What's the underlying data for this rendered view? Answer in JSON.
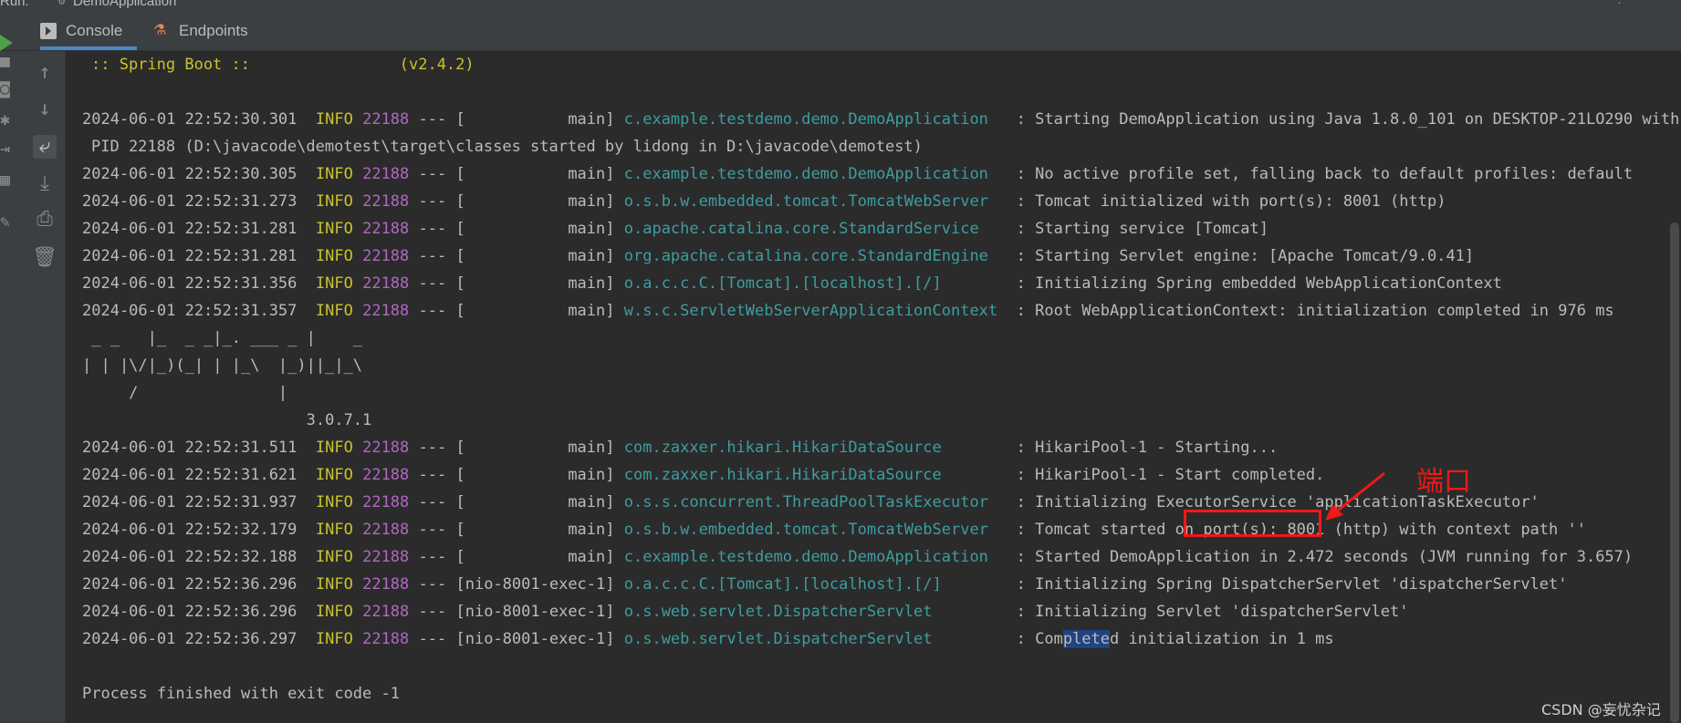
{
  "window": {
    "title": "DemoApplication",
    "title_prefix": "Run:"
  },
  "tabs": [
    {
      "label": "Console",
      "icon": "console-icon",
      "active": true
    },
    {
      "label": "Endpoints",
      "icon": "endpoints-icon",
      "active": false
    }
  ],
  "toolbar": [
    {
      "name": "scroll-up-icon",
      "glyph": "↑"
    },
    {
      "name": "scroll-down-icon",
      "glyph": "↓"
    },
    {
      "name": "soft-wrap-icon",
      "glyph": "⤶",
      "active": true
    },
    {
      "name": "scroll-to-end-icon",
      "glyph": "⤓"
    },
    {
      "name": "print-icon",
      "glyph": "⎙"
    },
    {
      "name": "trash-icon",
      "glyph": "🗑"
    }
  ],
  "toolbar_edge": [
    {
      "name": "stop-icon",
      "glyph": "■"
    },
    {
      "name": "camera-icon",
      "glyph": "◙"
    },
    {
      "name": "settings-icon",
      "glyph": "✱"
    },
    {
      "name": "login-icon",
      "glyph": "⇥"
    },
    {
      "name": "layout-icon",
      "glyph": "▦"
    },
    {
      "name": "pin-icon",
      "glyph": "✎"
    }
  ],
  "console": {
    "banner": ":: Spring Boot ::                (v2.4.2)",
    "ascii_art": [
      " _ _   |_  _ _|_. ___ _ |    _",
      "| | |\\/|_)(_| | |_\\  |_)||_|_\\",
      "     /               |",
      "                        3.0.7.1"
    ],
    "log": [
      {
        "ts": "2024-06-01 22:52:30.301",
        "level": "INFO",
        "pid": "22188",
        "sep": "---",
        "thread": "[           main]",
        "logger": "c.example.testdemo.demo.DemoApplication  ",
        "message": "Starting DemoApplication using Java 1.8.0_101 on DESKTOP-21LO290 with",
        "continuation": "PID 22188 (D:\\javacode\\demotest\\target\\classes started by lidong in D:\\javacode\\demotest)"
      },
      {
        "ts": "2024-06-01 22:52:30.305",
        "level": "INFO",
        "pid": "22188",
        "sep": "---",
        "thread": "[           main]",
        "logger": "c.example.testdemo.demo.DemoApplication  ",
        "message": "No active profile set, falling back to default profiles: default"
      },
      {
        "ts": "2024-06-01 22:52:31.273",
        "level": "INFO",
        "pid": "22188",
        "sep": "---",
        "thread": "[           main]",
        "logger": "o.s.b.w.embedded.tomcat.TomcatWebServer  ",
        "message": "Tomcat initialized with port(s): 8001 (http)"
      },
      {
        "ts": "2024-06-01 22:52:31.281",
        "level": "INFO",
        "pid": "22188",
        "sep": "---",
        "thread": "[           main]",
        "logger": "o.apache.catalina.core.StandardService   ",
        "message": "Starting service [Tomcat]"
      },
      {
        "ts": "2024-06-01 22:52:31.281",
        "level": "INFO",
        "pid": "22188",
        "sep": "---",
        "thread": "[           main]",
        "logger": "org.apache.catalina.core.StandardEngine  ",
        "message": "Starting Servlet engine: [Apache Tomcat/9.0.41]"
      },
      {
        "ts": "2024-06-01 22:52:31.356",
        "level": "INFO",
        "pid": "22188",
        "sep": "---",
        "thread": "[           main]",
        "logger": "o.a.c.c.C.[Tomcat].[localhost].[/]       ",
        "message": "Initializing Spring embedded WebApplicationContext"
      },
      {
        "ts": "2024-06-01 22:52:31.357",
        "level": "INFO",
        "pid": "22188",
        "sep": "---",
        "thread": "[           main]",
        "logger": "w.s.c.ServletWebServerApplicationContext ",
        "message": "Root WebApplicationContext: initialization completed in 976 ms"
      },
      {
        "ts": "2024-06-01 22:52:31.511",
        "level": "INFO",
        "pid": "22188",
        "sep": "---",
        "thread": "[           main]",
        "logger": "com.zaxxer.hikari.HikariDataSource       ",
        "message": "HikariPool-1 - Starting..."
      },
      {
        "ts": "2024-06-01 22:52:31.621",
        "level": "INFO",
        "pid": "22188",
        "sep": "---",
        "thread": "[           main]",
        "logger": "com.zaxxer.hikari.HikariDataSource       ",
        "message": "HikariPool-1 - Start completed."
      },
      {
        "ts": "2024-06-01 22:52:31.937",
        "level": "INFO",
        "pid": "22188",
        "sep": "---",
        "thread": "[           main]",
        "logger": "o.s.s.concurrent.ThreadPoolTaskExecutor  ",
        "message": "Initializing ExecutorService 'applicationTaskExecutor'"
      },
      {
        "ts": "2024-06-01 22:52:32.179",
        "level": "INFO",
        "pid": "22188",
        "sep": "---",
        "thread": "[           main]",
        "logger": "o.s.b.w.embedded.tomcat.TomcatWebServer  ",
        "message": "Tomcat started on port(s): 8001 (http) with context path ''"
      },
      {
        "ts": "2024-06-01 22:52:32.188",
        "level": "INFO",
        "pid": "22188",
        "sep": "---",
        "thread": "[           main]",
        "logger": "c.example.testdemo.demo.DemoApplication  ",
        "message": "Started DemoApplication in 2.472 seconds (JVM running for 3.657)"
      },
      {
        "ts": "2024-06-01 22:52:36.296",
        "level": "INFO",
        "pid": "22188",
        "sep": "---",
        "thread": "[nio-8001-exec-1]",
        "logger": "o.a.c.c.C.[Tomcat].[localhost].[/]       ",
        "message": "Initializing Spring DispatcherServlet 'dispatcherServlet'"
      },
      {
        "ts": "2024-06-01 22:52:36.296",
        "level": "INFO",
        "pid": "22188",
        "sep": "---",
        "thread": "[nio-8001-exec-1]",
        "logger": "o.s.web.servlet.DispatcherServlet        ",
        "message": "Initializing Servlet 'dispatcherServlet'"
      },
      {
        "ts": "2024-06-01 22:52:36.297",
        "level": "INFO",
        "pid": "22188",
        "sep": "---",
        "thread": "[nio-8001-exec-1]",
        "logger": "o.s.web.servlet.DispatcherServlet        ",
        "message": "Completed initialization in 1 ms",
        "highlight": "Complete"
      }
    ],
    "exit_message": "Process finished with exit code -1"
  },
  "annotation": {
    "label": "端口",
    "color": "#f01818"
  },
  "watermark": "CSDN @妄忧杂记",
  "colors": {
    "background": "#2b2b2b",
    "panel": "#3c3f41",
    "text": "#bbbbbb",
    "info_level": "#c8c32b",
    "pid": "#b267c4",
    "logger": "#3e9da0",
    "highlight": "#214283",
    "accent": "#4a88c7",
    "run": "#4fa04b"
  }
}
